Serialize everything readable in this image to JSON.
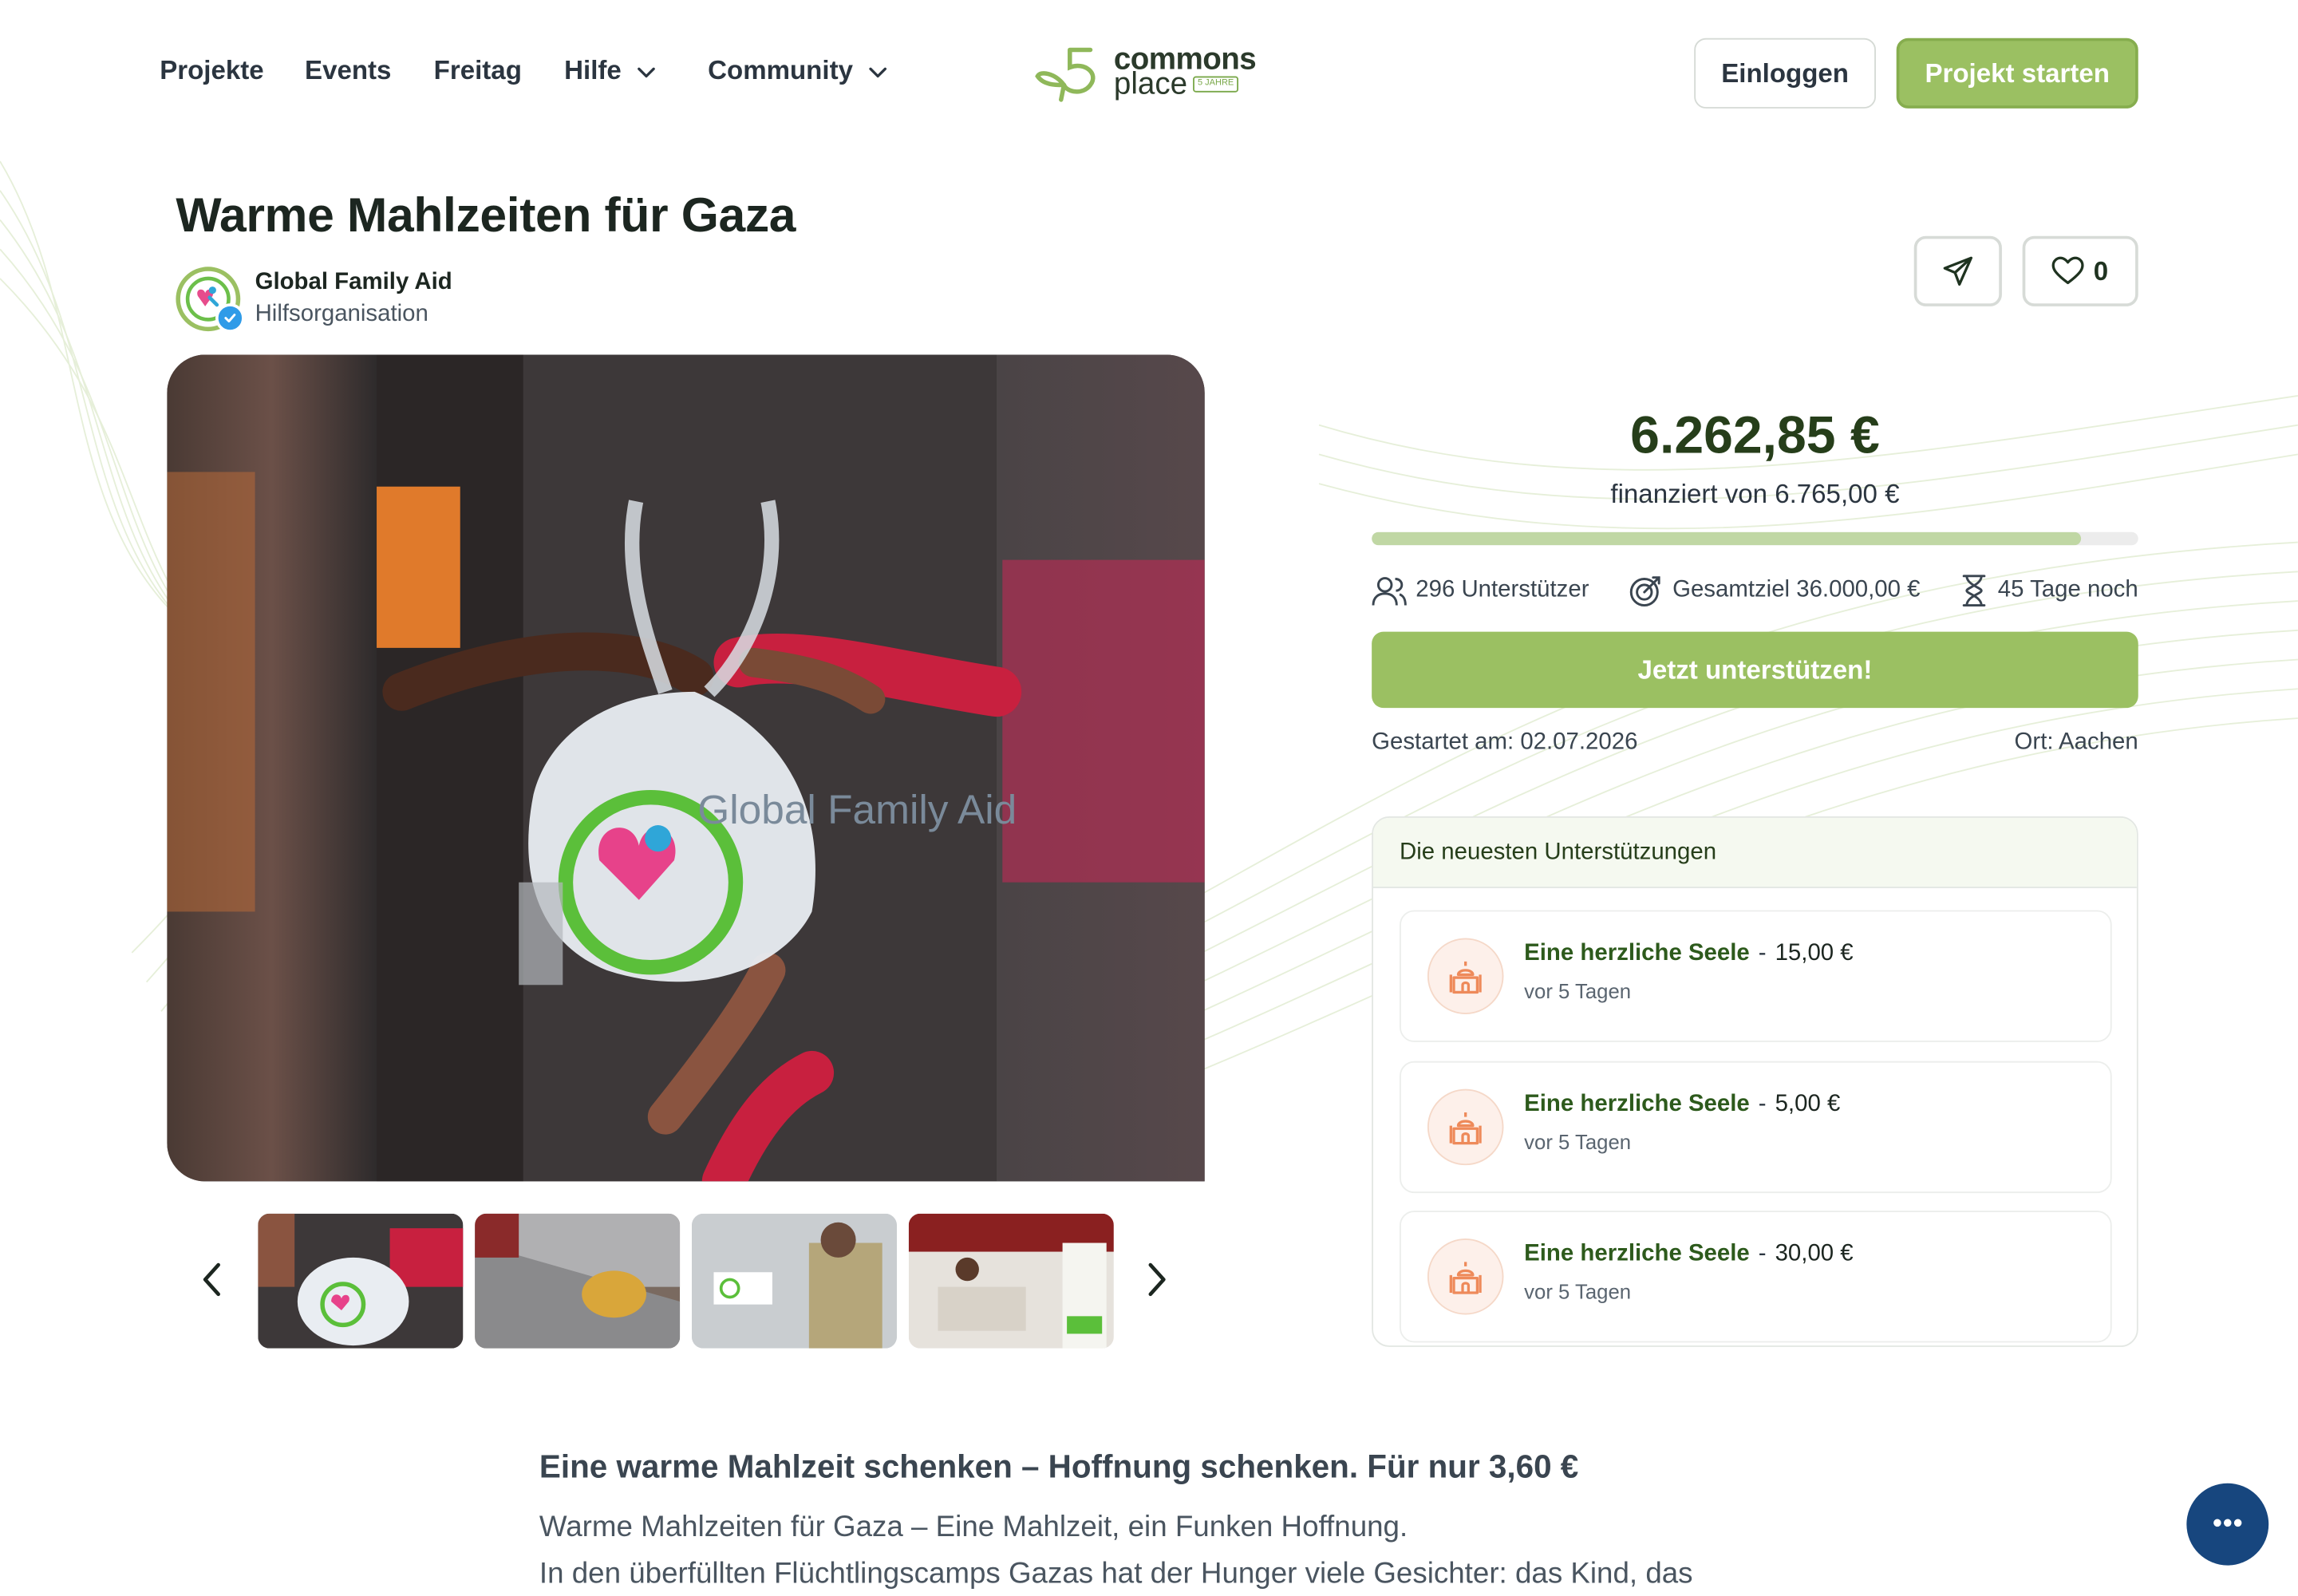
{
  "nav": {
    "items": [
      {
        "label": "Projekte"
      },
      {
        "label": "Events"
      },
      {
        "label": "Freitag"
      },
      {
        "label": "Hilfe"
      },
      {
        "label": "Community"
      }
    ],
    "logo": {
      "top": "commons",
      "bottom": "place",
      "badge": "5 JAHRE"
    },
    "login_label": "Einloggen",
    "start_label": "Projekt starten"
  },
  "project": {
    "title": "Warme Mahlzeiten für Gaza",
    "org_name": "Global Family Aid",
    "org_type": "Hilfsorganisation",
    "likes": "0",
    "image_bag_text": "Global Family Aid"
  },
  "funding": {
    "amount": "6.262,85 €",
    "funded_of": "finanziert von 6.765,00 €",
    "progress_fraction": 0.926,
    "supporters": "296 Unterstützer",
    "goal": "Gesamtziel 36.000,00 €",
    "days_left": "45 Tage noch",
    "support_button": "Jetzt unterstützen!",
    "started": "Gestartet am: 02.07.2026",
    "location": "Ort: Aachen"
  },
  "latest": {
    "heading": "Die neuesten Unterstützungen",
    "items": [
      {
        "name": "Eine herzliche Seele",
        "dash": "-",
        "amount": "15,00 €",
        "time": "vor 5 Tagen"
      },
      {
        "name": "Eine herzliche Seele",
        "dash": "-",
        "amount": "5,00 €",
        "time": "vor 5 Tagen"
      },
      {
        "name": "Eine herzliche Seele",
        "dash": "-",
        "amount": "30,00 €",
        "time": "vor 5 Tagen"
      }
    ]
  },
  "description": {
    "heading": "Eine warme Mahlzeit schenken – Hoffnung schenken. Für nur 3,60 €",
    "line1": "Warme Mahlzeiten für Gaza – Eine Mahlzeit, ein Funken Hoffnung.",
    "line2": "In den überfüllten Flüchtlingscamps Gazas hat der Hunger viele Gesichter: das Kind, das"
  },
  "colors": {
    "brand_green": "#9bc062",
    "dark_green": "#263e1a",
    "chat_blue": "#17467e"
  },
  "icons": {
    "share": "paper-plane-icon",
    "like": "heart-icon",
    "supporters": "people-icon",
    "goal": "target-icon",
    "time": "hourglass-icon",
    "supporter_avatar": "mosque-icon",
    "chat": "chat-bubble-icon"
  }
}
